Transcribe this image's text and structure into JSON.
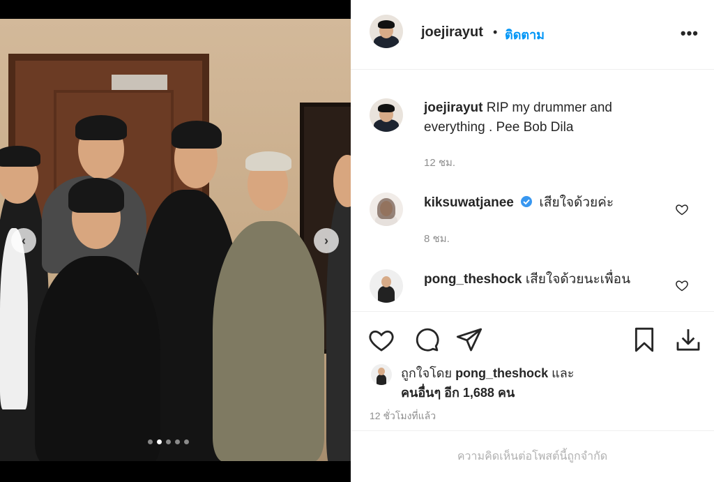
{
  "post": {
    "username": "joejirayut",
    "follow_label": "ติดตาม",
    "bullet": "•"
  },
  "caption": {
    "username": "joejirayut",
    "text_line1": "RIP my drummer and",
    "text_line2": "everything . Pee Bob Dila",
    "time": "12 ชม."
  },
  "comments": [
    {
      "username": "kiksuwatjanee",
      "verified": true,
      "text": "เสียใจด้วยค่ะ",
      "time": "8 ชม."
    },
    {
      "username": "pong_theshock",
      "verified": false,
      "text": "เสียใจด้วยนะเพื่อน",
      "time": ""
    }
  ],
  "likes": {
    "prefix": "ถูกใจโดย",
    "username": "pong_theshock",
    "suffix": "และ",
    "line2": "คนอื่นๆ อีก 1,688 คน"
  },
  "post_age": "12 ชั่วโมงที่แล้ว",
  "comments_limited": "ความคิดเห็นต่อโพสต์นี้ถูกจำกัด",
  "carousel": {
    "total_slides": 5,
    "active_slide": 2
  },
  "colors": {
    "link_blue": "#0095f6",
    "text": "#262626",
    "muted": "#8e8e8e",
    "verified": "#3897f0"
  },
  "icons": [
    "more-options-icon",
    "heart-icon",
    "comment-icon",
    "share-icon",
    "bookmark-icon",
    "download-icon",
    "chevron-left-icon",
    "chevron-right-icon",
    "verified-badge-icon"
  ]
}
